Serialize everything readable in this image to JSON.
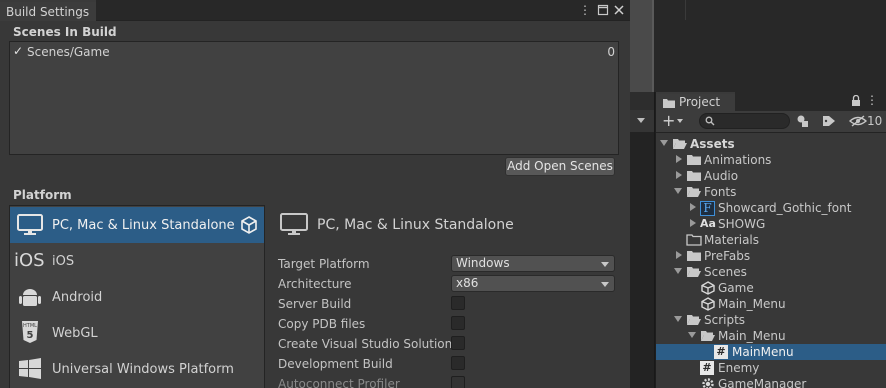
{
  "build_settings": {
    "tab_title": "Build Settings",
    "scenes_header": "Scenes In Build",
    "scenes": [
      {
        "name": "Scenes/Game",
        "index": "0",
        "checked": true
      }
    ],
    "add_open_scenes_label": "Add Open Scenes",
    "platform_header": "Platform",
    "platforms": [
      {
        "label": "PC, Mac & Linux Standalone",
        "icon": "monitor-icon",
        "selected": true
      },
      {
        "label": "iOS",
        "icon": "ios-icon",
        "selected": false
      },
      {
        "label": "Android",
        "icon": "android-icon",
        "selected": false
      },
      {
        "label": "WebGL",
        "icon": "html5-icon",
        "selected": false
      },
      {
        "label": "Universal Windows Platform",
        "icon": "windows-icon",
        "selected": false
      }
    ],
    "details": {
      "title": "PC, Mac & Linux Standalone",
      "target_platform_label": "Target Platform",
      "target_platform_value": "Windows",
      "architecture_label": "Architecture",
      "architecture_value": "x86",
      "server_build_label": "Server Build",
      "copy_pdb_label": "Copy PDB files",
      "create_vs_label": "Create Visual Studio Solution",
      "development_build_label": "Development Build",
      "autoconnect_label": "Autoconnect Profiler"
    },
    "accent_color": "#2c5d87"
  },
  "project": {
    "tab_title": "Project",
    "hidden_count": "10",
    "tree": [
      {
        "label": "Assets",
        "bold": true,
        "expanded": true,
        "icon": "folder-open-icon"
      },
      {
        "label": "Animations",
        "icon": "folder-icon"
      },
      {
        "label": "Audio",
        "icon": "folder-icon"
      },
      {
        "label": "Fonts",
        "icon": "folder-open-icon"
      },
      {
        "label": "Showcard_Gothic_font",
        "icon": "font-asset-icon"
      },
      {
        "label": "SHOWG",
        "icon": "font-icon",
        "icon_text": "Aa"
      },
      {
        "label": "Materials",
        "icon": "folder-icon"
      },
      {
        "label": "PreFabs",
        "icon": "folder-icon"
      },
      {
        "label": "Scenes",
        "icon": "folder-open-icon"
      },
      {
        "label": "Game",
        "icon": "unity-scene-icon"
      },
      {
        "label": "Main_Menu",
        "icon": "unity-scene-icon"
      },
      {
        "label": "Scripts",
        "icon": "folder-open-icon"
      },
      {
        "label": "Main_Menu",
        "icon": "folder-open-icon"
      },
      {
        "label": "MainMenu",
        "icon": "csharp-script-icon",
        "selected": true
      },
      {
        "label": "Enemy",
        "icon": "csharp-script-icon"
      },
      {
        "label": "GameManager",
        "icon": "gear-script-icon"
      }
    ]
  }
}
